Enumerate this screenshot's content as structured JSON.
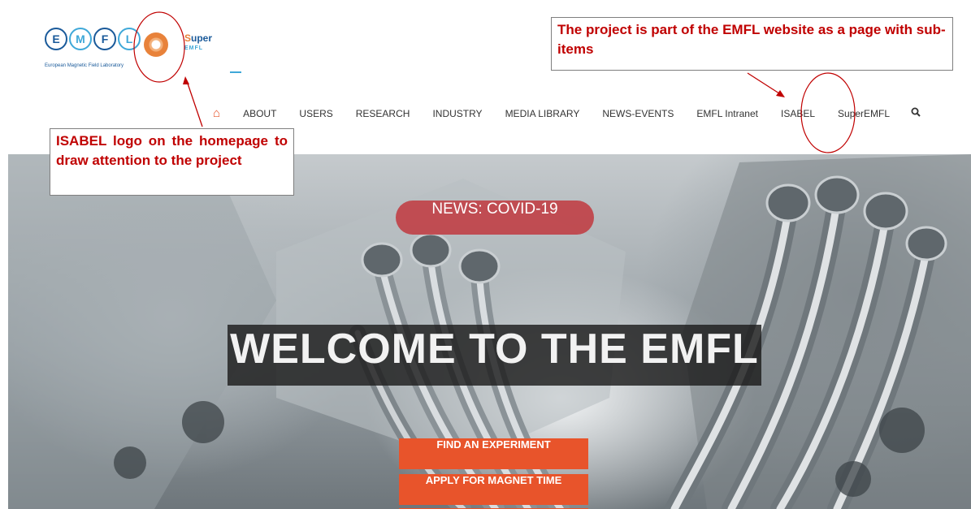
{
  "header": {
    "logo": {
      "letters": [
        "E",
        "M",
        "F",
        "L"
      ],
      "tagline": "European Magnetic Field Laboratory"
    },
    "isabel_logo": {
      "icon": "lifebuoy-icon"
    },
    "superemfl_logo": {
      "super_s": "S",
      "super_rest": "uper",
      "sub": "EMFL"
    }
  },
  "nav": {
    "home_icon": "⌂",
    "items": [
      "ABOUT",
      "USERS",
      "RESEARCH",
      "INDUSTRY",
      "MEDIA LIBRARY",
      "NEWS-EVENTS",
      "EMFL Intranet",
      "ISABEL",
      "SuperEMFL"
    ],
    "search_icon": "⚲"
  },
  "hero": {
    "news_badge": "NEWS: COVID-19",
    "welcome_title": "WELCOME TO THE EMFL",
    "cta": [
      "FIND AN EXPERIMENT",
      "APPLY FOR MAGNET TIME"
    ]
  },
  "annotations": {
    "top_right": "The project is part of the EMFL website as a page with sub-items",
    "left": "ISABEL logo on the homepage to draw attention to the project"
  },
  "colors": {
    "accent_orange": "#e8542b",
    "badge_red": "#c03c42",
    "annotation_red": "#c00000",
    "logo_blue": "#1a5a9a"
  }
}
